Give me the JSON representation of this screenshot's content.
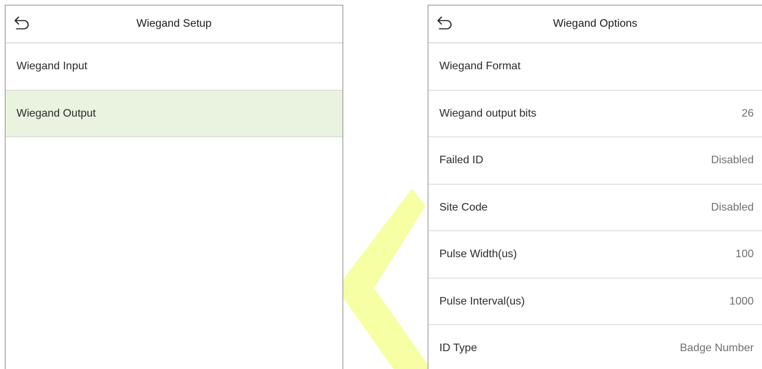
{
  "setup_panel": {
    "title": "Wiegand Setup",
    "back_icon": "back-arrow-icon",
    "items": [
      {
        "label": "Wiegand Input",
        "selected": false
      },
      {
        "label": "Wiegand Output",
        "selected": true
      }
    ]
  },
  "options_panel": {
    "title": "Wiegand Options",
    "back_icon": "back-arrow-icon",
    "items": [
      {
        "label": "Wiegand Format",
        "value": ""
      },
      {
        "label": "Wiegand output bits",
        "value": "26"
      },
      {
        "label": "Failed ID",
        "value": "Disabled"
      },
      {
        "label": "Site Code",
        "value": "Disabled"
      },
      {
        "label": "Pulse Width(us)",
        "value": "100"
      },
      {
        "label": "Pulse Interval(us)",
        "value": "1000"
      },
      {
        "label": "ID Type",
        "value": "Badge Number"
      }
    ]
  },
  "colors": {
    "selected_row": "#e9f3df",
    "watermark": "#eaff00"
  }
}
